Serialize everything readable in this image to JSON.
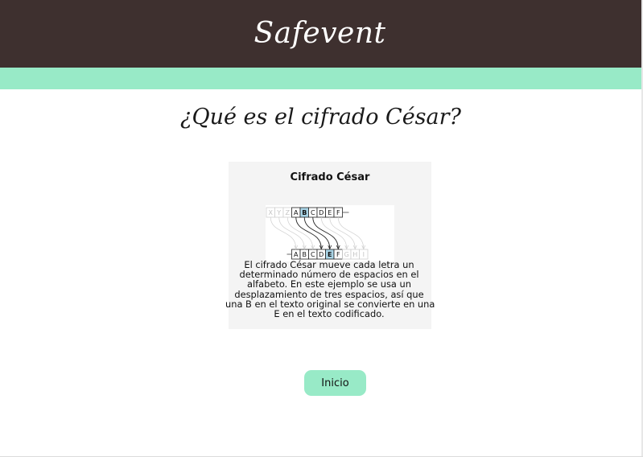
{
  "header": {
    "brand": "Safevent"
  },
  "page": {
    "title": "¿Qué es el cifrado César?"
  },
  "card": {
    "title": "Cifrado César",
    "diagram": {
      "top_row": [
        "X",
        "Y",
        "Z",
        "A",
        "B",
        "C",
        "D",
        "E",
        "F"
      ],
      "bottom_row": [
        "A",
        "B",
        "C",
        "D",
        "E",
        "F",
        "G",
        "H",
        "I"
      ],
      "highlight_top": "B",
      "highlight_bottom": "E"
    },
    "caption_lines": [
      "El cifrado César mueve cada letra un",
      "determinado número de espacios en el",
      "alfabeto. En este ejemplo se usa un",
      "desplazamiento de tres espacios, así que",
      "una B en el texto original se convierte en una",
      "E en el texto codificado."
    ]
  },
  "actions": {
    "home_label": "Inicio"
  },
  "colors": {
    "header_bg": "#3e302f",
    "accent": "#98eac7",
    "card_bg": "#f4f4f4",
    "highlight": "#a9d4e6"
  }
}
